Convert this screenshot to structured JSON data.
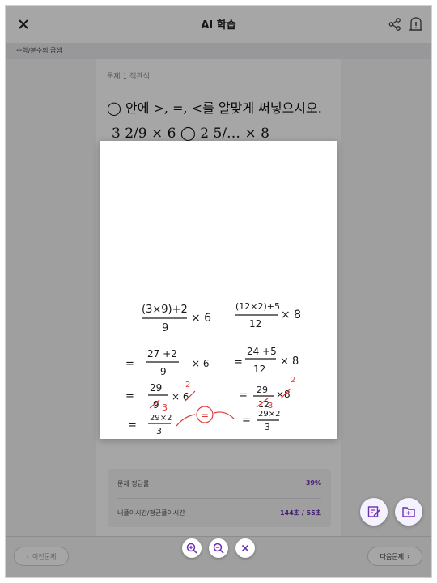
{
  "header": {
    "title": "AI 학습",
    "close_icon": "close-icon",
    "share_icon": "share-icon",
    "notice_icon": "notice-icon"
  },
  "breadcrumb": "수학/분수의 곱셈",
  "question": {
    "type_label": "문제 1 객관식",
    "text": "◯ 안에 >, =, <를 알맞게 써넣으시오.",
    "expression_visible": "3 2/9 × 6 ◯ 2 5/… × 8"
  },
  "stats": {
    "accuracy_label": "문제 정답률",
    "accuracy_value": "39%",
    "time_label": "내풀이시간/평균풀이시간",
    "time_value": "144초 / 55초"
  },
  "navigation": {
    "prev_label": "이전문제",
    "next_label": "다음문제"
  },
  "handwriting": {
    "left_steps": [
      "(3×9)+2 / 9 × 6",
      "= 27+2 / 9 × 6",
      "= 29 / 9 × 6",
      "= 29×2 / 3"
    ],
    "right_steps": [
      "(12×2)+5 / 12 × 8",
      "= 24+5 / 12 × 8",
      "= 29 / 12 × 8",
      "= 29×2 / 3"
    ],
    "annotation": "=",
    "ink_color": "#1a1a1a",
    "correction_color": "#e53935"
  },
  "colors": {
    "accent": "#6b2fb5",
    "overlay": "rgba(0,0,0,0.35)"
  }
}
